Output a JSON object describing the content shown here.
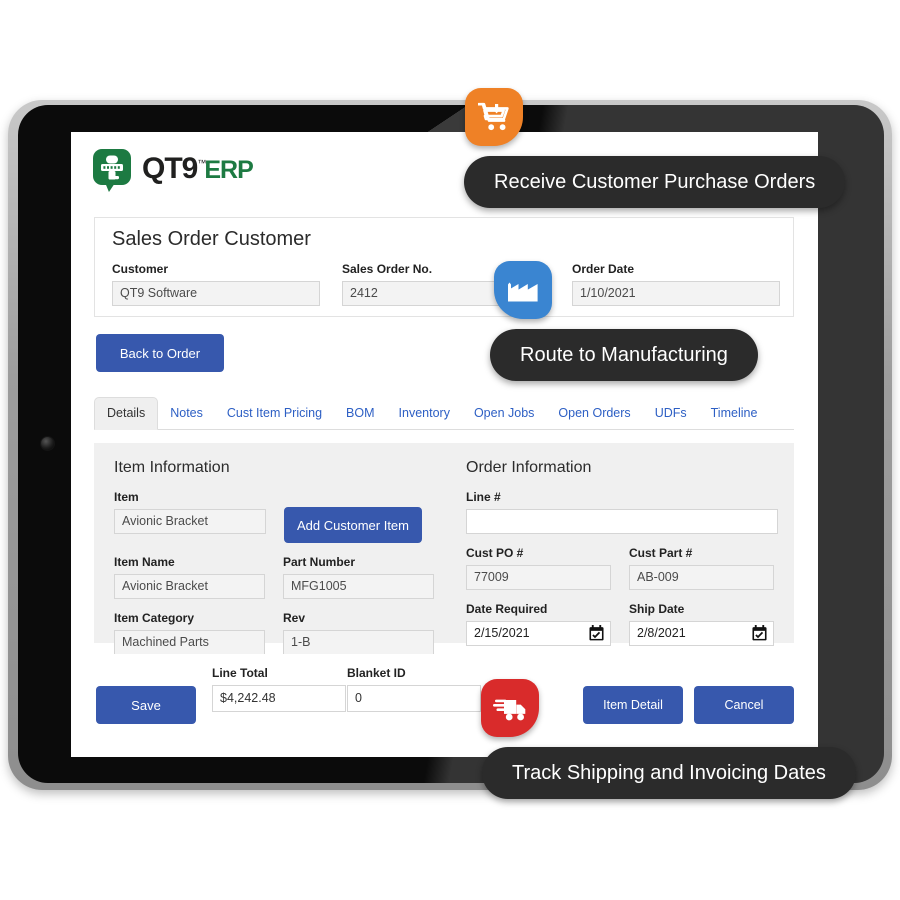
{
  "app": {
    "brand_name": "QT9",
    "brand_tm": "™",
    "brand_suffix": "ERP",
    "logo_icon": "qt9-speech-bubble-logo"
  },
  "sales_order_card": {
    "title": "Sales Order Customer",
    "fields": [
      {
        "label": "Customer",
        "value": "QT9 Software"
      },
      {
        "label": "Sales Order No.",
        "value": "2412"
      },
      {
        "label": "Order Date",
        "value": "1/10/2021"
      }
    ]
  },
  "actions": {
    "back_to_order": "Back to Order"
  },
  "tabs": [
    {
      "label": "Details",
      "active": true
    },
    {
      "label": "Notes",
      "active": false
    },
    {
      "label": "Cust Item Pricing",
      "active": false
    },
    {
      "label": "BOM",
      "active": false
    },
    {
      "label": "Inventory",
      "active": false
    },
    {
      "label": "Open Jobs",
      "active": false
    },
    {
      "label": "Open Orders",
      "active": false
    },
    {
      "label": "UDFs",
      "active": false
    },
    {
      "label": "Timeline",
      "active": false
    }
  ],
  "item_information": {
    "section_title": "Item Information",
    "item": {
      "label": "Item",
      "value": "Avionic Bracket"
    },
    "add_item_button": "Add Customer Item",
    "item_name": {
      "label": "Item Name",
      "value": "Avionic Bracket"
    },
    "part_number": {
      "label": "Part Number",
      "value": "MFG1005"
    },
    "item_category": {
      "label": "Item Category",
      "value": "Machined Parts"
    },
    "rev": {
      "label": "Rev",
      "value": "1-B"
    }
  },
  "order_information": {
    "section_title": "Order Information",
    "line_no": {
      "label": "Line #",
      "value": ""
    },
    "cust_po": {
      "label": "Cust PO #",
      "value": "77009"
    },
    "cust_part": {
      "label": "Cust Part #",
      "value": "AB-009"
    },
    "date_required": {
      "label": "Date Required",
      "value": "2/15/2021",
      "icon": "calendar-icon"
    },
    "ship_date": {
      "label": "Ship Date",
      "value": "2/8/2021",
      "icon": "calendar-icon"
    }
  },
  "footer": {
    "save_label": "Save",
    "line_total": {
      "label": "Line Total",
      "value": "$4,242.48"
    },
    "blanket_id": {
      "label": "Blanket ID",
      "value": "0"
    },
    "item_detail_label": "Item Detail",
    "cancel_label": "Cancel"
  },
  "callouts": [
    {
      "text": "Receive Customer Purchase Orders",
      "icon": "shopping-cart-download-icon",
      "color": "#ef8126"
    },
    {
      "text": "Route to Manufacturing",
      "icon": "factory-icon",
      "color": "#3a85d1"
    },
    {
      "text": "Track Shipping and Invoicing Dates",
      "icon": "delivery-truck-icon",
      "color": "#d92b2b"
    }
  ],
  "colors": {
    "primary_button": "#3758ad",
    "brand_green": "#1d7a42",
    "tab_link": "#2d5fc4",
    "panel_gray": "#f0f0f0",
    "callout_dark": "#2b2b2b"
  },
  "device": {
    "type": "tablet",
    "camera": "front-camera"
  }
}
